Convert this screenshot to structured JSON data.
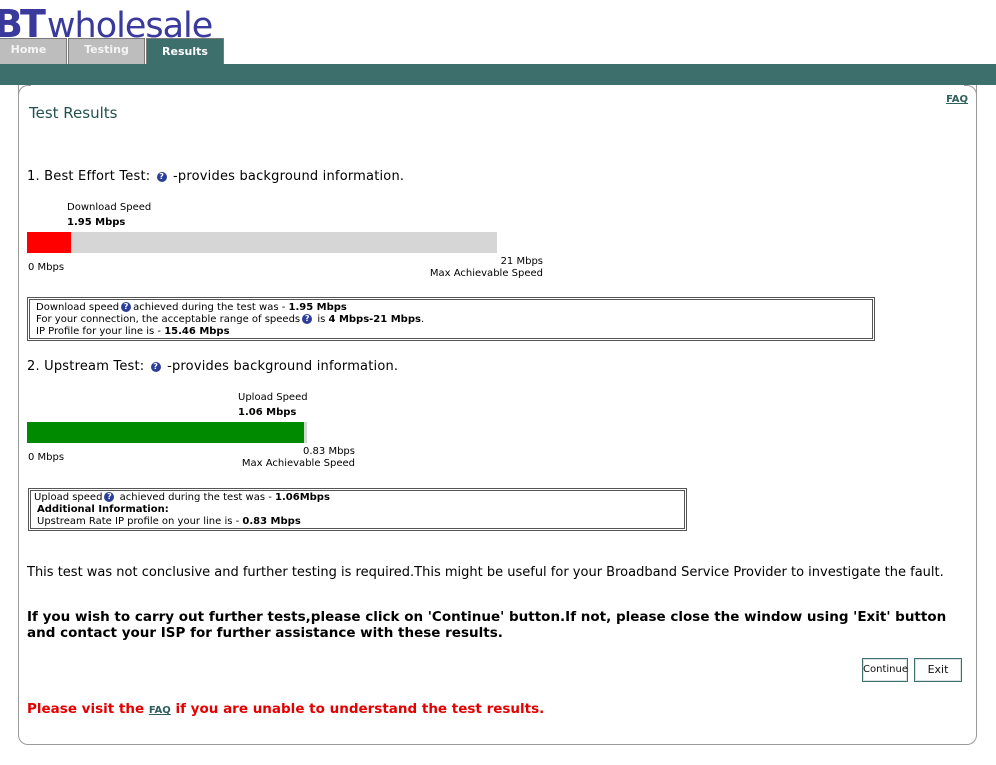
{
  "header": {
    "logo_bt": "BT",
    "logo_wholesale": "wholesale",
    "tabs": [
      {
        "label": "Home",
        "active": false
      },
      {
        "label": "Testing",
        "active": false
      },
      {
        "label": "Results",
        "active": true
      }
    ]
  },
  "main": {
    "faq_link": "FAQ",
    "title": "Test Results",
    "best_effort": {
      "heading": "1. Best Effort Test:",
      "heading_suffix": "-provides background information.",
      "bar_label": "Download  Speed",
      "speed_value": "1.95 Mbps",
      "min_label": "0 Mbps",
      "max_value": "21 Mbps",
      "max_label": "Max Achievable Speed",
      "fill_fraction": 0.0929,
      "fill_color": "#ff0000",
      "info": {
        "line1_prefix": "Download speed",
        "line1_mid": "achieved during the test was - ",
        "line1_value": "1.95 Mbps",
        "line2_prefix": "For your connection, the acceptable range of speeds",
        "line2_mid": " is ",
        "line2_value": "4 Mbps-21 Mbps",
        "line2_suffix": ".",
        "line3_prefix": "IP Profile for your line is - ",
        "line3_value": "15.46 Mbps"
      }
    },
    "upstream": {
      "heading": "2. Upstream Test:",
      "heading_suffix": "-provides background information.",
      "bar_label": "Upload Speed",
      "speed_value": "1.06 Mbps",
      "min_label": "0 Mbps",
      "max_value": "0.83 Mbps",
      "max_label": "Max Achievable Speed",
      "fill_fraction": 0.99,
      "fill_color": "#008a00",
      "info": {
        "line1_prefix": "Upload speed",
        "line1_mid": " achieved during the test was - ",
        "line1_value": "1.06Mbps",
        "line2": "Additional Information:",
        "line3_prefix": "Upstream Rate IP profile on your line is - ",
        "line3_value": "0.83 Mbps"
      }
    },
    "conclusion": "This test was not conclusive and further testing is required.This might be useful for your Broadband Service Provider to investigate the fault.",
    "instruction": "If you wish to carry out further tests,please click on 'Continue' button.If not, please close the window using 'Exit' button and contact your ISP for further assistance with these results.",
    "continue_label": "Continue",
    "exit_label": "Exit",
    "faq_prefix": "Please visit the ",
    "faq_inline": "FAQ",
    "faq_suffix": " if you are unable to understand the test results."
  },
  "icons": {
    "help": "help-icon"
  },
  "colors": {
    "brand": "#3a3a9c",
    "teal": "#3d6f6d",
    "warning": "#e40000"
  }
}
